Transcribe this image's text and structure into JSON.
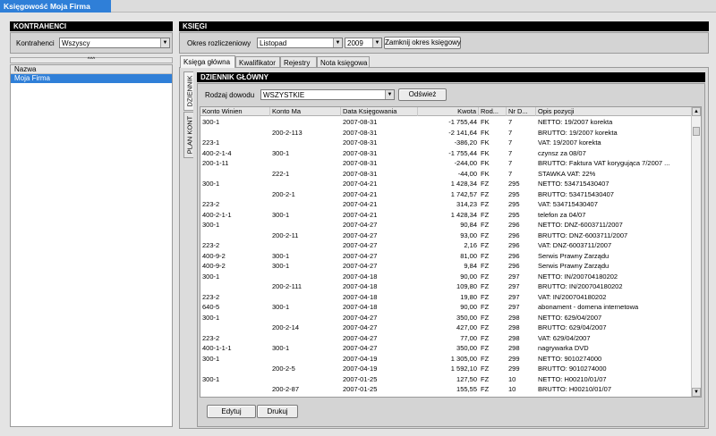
{
  "app_tab": "Księgowość  Moja Firma",
  "left_panel": {
    "title": "KONTRAHENCI",
    "filter_label": "Kontrahenci",
    "filter_value": "Wszyscy",
    "collapse_glyph": "^^^",
    "list_header": "Nazwa",
    "list_items": [
      "Moja Firma"
    ]
  },
  "right_panel": {
    "title": "KSIĘGI",
    "period_label": "Okres rozliczeniowy",
    "month_value": "Listopad",
    "year_value": "2009",
    "close_period_button": "Zamknij okres księgowy",
    "tabs": [
      "Księga główna",
      "Kwalifikator",
      "Rejestry",
      "Nota księgowa"
    ],
    "vertical_tabs": [
      "DZIENNIK",
      "PLAN KONT"
    ],
    "journal": {
      "title": "DZIENNIK GŁÓWNY",
      "doc_type_label": "Rodzaj dowodu",
      "doc_type_value": "WSZYSTKIE",
      "refresh_button": "Odśwież",
      "columns": [
        "Konto Winien",
        "Konto Ma",
        "Data Księgowania",
        "Kwota",
        "Rod...",
        "Nr D...",
        "Opis pozycji"
      ],
      "rows": [
        [
          "300-1",
          "",
          "2007-08-31",
          "-1 755,44",
          "FK",
          "7",
          "NETTO: 19/2007 korekta"
        ],
        [
          "",
          "200-2-113",
          "2007-08-31",
          "-2 141,64",
          "FK",
          "7",
          "BRUTTO: 19/2007 korekta"
        ],
        [
          "223-1",
          "",
          "2007-08-31",
          "-386,20",
          "FK",
          "7",
          "VAT: 19/2007 korekta"
        ],
        [
          "400-2-1-4",
          "300-1",
          "2007-08-31",
          "-1 755,44",
          "FK",
          "7",
          "czynsz za 08/07"
        ],
        [
          "200-1-11",
          "",
          "2007-08-31",
          "-244,00",
          "FK",
          "7",
          "BRUTTO: Faktura VAT korygująca 7/2007 ..."
        ],
        [
          "",
          "222-1",
          "2007-08-31",
          "-44,00",
          "FK",
          "7",
          "STAWKA VAT: 22%"
        ],
        [
          "300-1",
          "",
          "2007-04-21",
          "1 428,34",
          "FZ",
          "295",
          "NETTO: 534715430407"
        ],
        [
          "",
          "200-2-1",
          "2007-04-21",
          "1 742,57",
          "FZ",
          "295",
          "BRUTTO: 534715430407"
        ],
        [
          "223-2",
          "",
          "2007-04-21",
          "314,23",
          "FZ",
          "295",
          "VAT: 534715430407"
        ],
        [
          "400-2-1-1",
          "300-1",
          "2007-04-21",
          "1 428,34",
          "FZ",
          "295",
          "telefon za 04/07"
        ],
        [
          "300-1",
          "",
          "2007-04-27",
          "90,84",
          "FZ",
          "296",
          "NETTO: DNZ-6003711/2007"
        ],
        [
          "",
          "200-2-11",
          "2007-04-27",
          "93,00",
          "FZ",
          "296",
          "BRUTTO: DNZ-6003711/2007"
        ],
        [
          "223-2",
          "",
          "2007-04-27",
          "2,16",
          "FZ",
          "296",
          "VAT: DNZ-6003711/2007"
        ],
        [
          "400-9-2",
          "300-1",
          "2007-04-27",
          "81,00",
          "FZ",
          "296",
          "Serwis Prawny Zarządu"
        ],
        [
          "400-9-2",
          "300-1",
          "2007-04-27",
          "9,84",
          "FZ",
          "296",
          "Serwis Prawny Zarządu"
        ],
        [
          "300-1",
          "",
          "2007-04-18",
          "90,00",
          "FZ",
          "297",
          "NETTO: IN/200704180202"
        ],
        [
          "",
          "200-2-111",
          "2007-04-18",
          "109,80",
          "FZ",
          "297",
          "BRUTTO: IN/200704180202"
        ],
        [
          "223-2",
          "",
          "2007-04-18",
          "19,80",
          "FZ",
          "297",
          "VAT: IN/200704180202"
        ],
        [
          "640-5",
          "300-1",
          "2007-04-18",
          "90,00",
          "FZ",
          "297",
          "abonament - domena internetowa"
        ],
        [
          "300-1",
          "",
          "2007-04-27",
          "350,00",
          "FZ",
          "298",
          "NETTO: 629/04/2007"
        ],
        [
          "",
          "200-2-14",
          "2007-04-27",
          "427,00",
          "FZ",
          "298",
          "BRUTTO: 629/04/2007"
        ],
        [
          "223-2",
          "",
          "2007-04-27",
          "77,00",
          "FZ",
          "298",
          "VAT: 629/04/2007"
        ],
        [
          "400-1-1-1",
          "300-1",
          "2007-04-27",
          "350,00",
          "FZ",
          "298",
          "nagrywarka DVD"
        ],
        [
          "300-1",
          "",
          "2007-04-19",
          "1 305,00",
          "FZ",
          "299",
          "NETTO: 9010274000"
        ],
        [
          "",
          "200-2-5",
          "2007-04-19",
          "1 592,10",
          "FZ",
          "299",
          "BRUTTO: 9010274000"
        ],
        [
          "300-1",
          "",
          "2007-01-25",
          "127,50",
          "FZ",
          "10",
          "NETTO: H00210/01/07"
        ],
        [
          "",
          "200-2-87",
          "2007-01-25",
          "155,55",
          "FZ",
          "10",
          "BRUTTO: H00210/01/07"
        ]
      ],
      "edit_button": "Edytuj",
      "print_button": "Drukuj"
    }
  }
}
